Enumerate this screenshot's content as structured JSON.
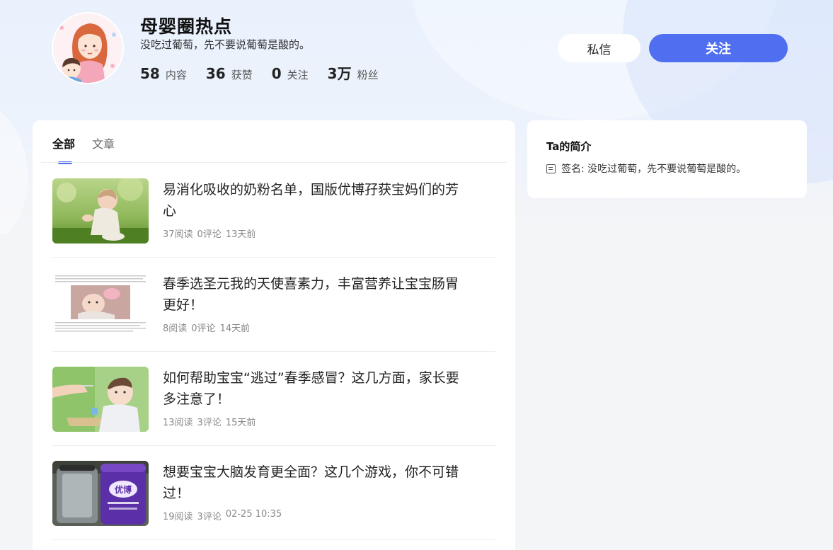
{
  "profile": {
    "name": "母婴圈热点",
    "bio": "没吃过葡萄，先不要说葡萄是酸的。",
    "stats": [
      {
        "num": "58",
        "label": "内容"
      },
      {
        "num": "36",
        "label": "获赞"
      },
      {
        "num": "0",
        "label": "关注"
      },
      {
        "num": "3万",
        "label": "粉丝"
      }
    ]
  },
  "actions": {
    "message_label": "私信",
    "follow_label": "关注"
  },
  "tabs": [
    {
      "label": "全部",
      "active": true
    },
    {
      "label": "文章",
      "active": false
    }
  ],
  "articles": [
    {
      "title": "易消化吸收的奶粉名单，国版优博孖获宝妈们的芳心",
      "reads": "37阅读",
      "comments": "0评论",
      "time": "13天前"
    },
    {
      "title": "春季选圣元我的天使喜素力，丰富营养让宝宝肠胃更好！",
      "reads": "8阅读",
      "comments": "0评论",
      "time": "14天前"
    },
    {
      "title": "如何帮助宝宝“逃过”春季感冒？这几方面，家长要多注意了！",
      "reads": "13阅读",
      "comments": "3评论",
      "time": "15天前"
    },
    {
      "title": "想要宝宝大脑发育更全面？这几个游戏，你不可错过！",
      "reads": "19阅读",
      "comments": "3评论",
      "time": "02-25 10:35"
    }
  ],
  "intro": {
    "title": "Ta的简介",
    "signature": "签名: 没吃过葡萄，先不要说葡萄是酸的。"
  },
  "thumb_labels": {
    "product": "优博"
  },
  "colors": {
    "accent": "#4f6ef0",
    "background": "#f4f5f7"
  }
}
